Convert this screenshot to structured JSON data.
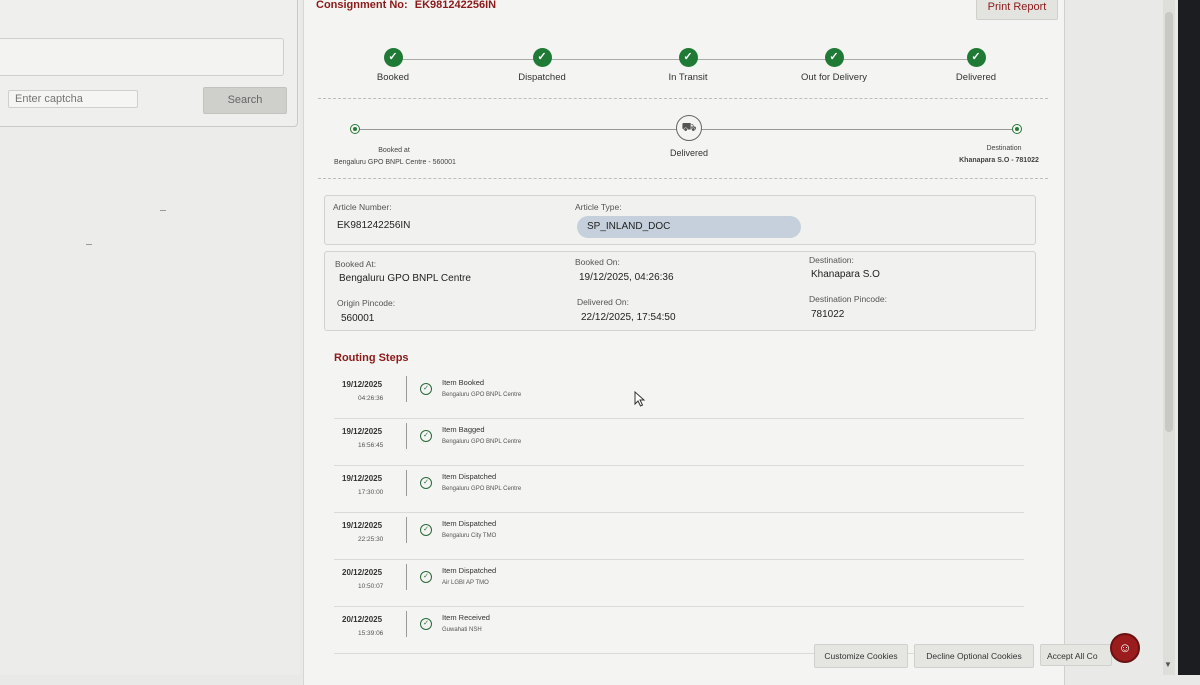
{
  "search": {
    "captcha_placeholder": "Enter captcha",
    "search_label": "Search"
  },
  "header": {
    "consignment_label": "Consignment No:",
    "consignment_number": "EK981242256IN",
    "print_report": "Print Report"
  },
  "progress": {
    "steps": [
      {
        "label": "Booked",
        "done": true
      },
      {
        "label": "Dispatched",
        "done": true
      },
      {
        "label": "In Transit",
        "done": true
      },
      {
        "label": "Out for Delivery",
        "done": true
      },
      {
        "label": "Delivered",
        "done": true
      }
    ]
  },
  "route": {
    "origin_label": "Booked at",
    "origin_value": "Bengaluru GPO BNPL Centre - 560001",
    "status": "Delivered",
    "destination_label": "Destination",
    "destination_value": "Khanapara S.O - 781022"
  },
  "article": {
    "number_label": "Article Number:",
    "number_value": "EK981242256IN",
    "type_label": "Article Type:",
    "type_value": "SP_INLAND_DOC"
  },
  "details": {
    "booked_at_label": "Booked At:",
    "booked_at_value": "Bengaluru GPO BNPL Centre",
    "booked_on_label": "Booked On:",
    "booked_on_value": "19/12/2025, 04:26:36",
    "destination_label": "Destination:",
    "destination_value": "Khanapara S.O",
    "origin_pincode_label": "Origin Pincode:",
    "origin_pincode_value": "560001",
    "delivered_on_label": "Delivered On:",
    "delivered_on_value": "22/12/2025, 17:54:50",
    "destination_pincode_label": "Destination Pincode:",
    "destination_pincode_value": "781022"
  },
  "routing": {
    "title": "Routing Steps",
    "steps": [
      {
        "date": "19/12/2025",
        "time": "04:26:36",
        "event": "Item Booked",
        "office": "Bengaluru GPO BNPL Centre"
      },
      {
        "date": "19/12/2025",
        "time": "16:56:45",
        "event": "Item Bagged",
        "office": "Bengaluru GPO BNPL Centre"
      },
      {
        "date": "19/12/2025",
        "time": "17:30:00",
        "event": "Item Dispatched",
        "office": "Bengaluru GPO BNPL Centre"
      },
      {
        "date": "19/12/2025",
        "time": "22:25:30",
        "event": "Item Dispatched",
        "office": "Bengaluru City TMO"
      },
      {
        "date": "20/12/2025",
        "time": "10:50:07",
        "event": "Item Dispatched",
        "office": "Air LGBI AP TMO"
      },
      {
        "date": "20/12/2025",
        "time": "15:39:06",
        "event": "Item Received",
        "office": "Guwahati NSH"
      }
    ]
  },
  "cookies": {
    "customize": "Customize Cookies",
    "decline": "Decline Optional Cookies",
    "accept": "Accept All Co"
  },
  "colors": {
    "accent": "#8b1a1a",
    "success": "#1f7a35",
    "pill": "#c5d0dc"
  },
  "icons": {
    "check": "check-icon",
    "truck": "truck-icon",
    "reader": "reader-icon"
  }
}
